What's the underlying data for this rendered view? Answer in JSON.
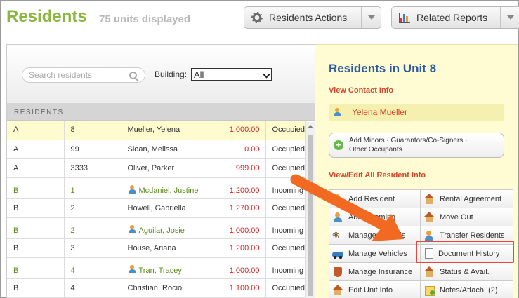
{
  "header": {
    "title": "Residents",
    "count_text": "75 units displayed",
    "actions_button": "Residents Actions",
    "reports_button": "Related Reports"
  },
  "filters": {
    "search_placeholder": "Search residents",
    "building_label": "Building:",
    "building_value": "All"
  },
  "table": {
    "section_label": "RESIDENTS",
    "rows": [
      {
        "building": "A",
        "unit": "8",
        "name": "Mueller, Yelena",
        "amount": "1,000.00",
        "status": "Occupied",
        "highlight": true,
        "person_icon": false,
        "green": false
      },
      {
        "building": "A",
        "unit": "99",
        "name": "Sloan, Melissa",
        "amount": "0.00",
        "status": "Occupied",
        "highlight": false,
        "person_icon": false,
        "green": false
      },
      {
        "building": "A",
        "unit": "3333",
        "name": "Oliver, Parker",
        "amount": "999.00",
        "status": "Occupied",
        "highlight": false,
        "person_icon": false,
        "green": false
      },
      {
        "building": "B",
        "unit": "1",
        "name": "Mcdaniel, Justine",
        "amount": "1,200.00",
        "status": "Incoming",
        "highlight": false,
        "person_icon": true,
        "green": true
      },
      {
        "building": "B",
        "unit": "2",
        "name": "Howell, Gabriella",
        "amount": "1,270.00",
        "status": "Occupied",
        "highlight": false,
        "person_icon": false,
        "green": false
      },
      {
        "building": "B",
        "unit": "2",
        "name": "Aguilar, Josie",
        "amount": "1,000.00",
        "status": "Incoming",
        "highlight": false,
        "person_icon": true,
        "green": true
      },
      {
        "building": "B",
        "unit": "3",
        "name": "House, Ariana",
        "amount": "1,200.00",
        "status": "Occupied",
        "highlight": false,
        "person_icon": false,
        "green": false
      },
      {
        "building": "B",
        "unit": "4",
        "name": "Tran, Tracey",
        "amount": "1,000.00",
        "status": "Incoming",
        "highlight": false,
        "person_icon": true,
        "green": true
      },
      {
        "building": "B",
        "unit": "4",
        "name": "Christian, Rocio",
        "amount": "1,100.00",
        "status": "Occupied",
        "highlight": false,
        "person_icon": false,
        "green": false
      }
    ]
  },
  "panel": {
    "title": "Residents in Unit 8",
    "view_contact": "View Contact Info",
    "contact_name": "Yelena Mueller",
    "minors_line1": "Add Minors · Guarantors/Co-Signers ·",
    "minors_line2": "Other Occupants",
    "view_edit_all": "View/Edit All Resident Info",
    "actions": [
      {
        "label": "Add Resident",
        "icon": "person-icon"
      },
      {
        "label": "Rental Agreement",
        "icon": "house-icon"
      },
      {
        "label": "Add Incoming",
        "icon": "person-icon"
      },
      {
        "label": "Move Out",
        "icon": "house-icon"
      },
      {
        "label": "Manage Animals",
        "icon": "paw-icon"
      },
      {
        "label": "Transfer Residents",
        "icon": "person-icon"
      },
      {
        "label": "Manage Vehicles",
        "icon": "car-icon"
      },
      {
        "label": "Document History",
        "icon": "document-icon"
      },
      {
        "label": "Manage Insurance",
        "icon": "shield-icon"
      },
      {
        "label": "Status & Avail.",
        "icon": "house-icon"
      },
      {
        "label": "Edit Unit Info",
        "icon": "house-icon"
      },
      {
        "label": "Notes/Attach. (2)",
        "icon": "note-icon"
      }
    ]
  },
  "colors": {
    "accent_green": "#8bb63f",
    "title_blue": "#2a5aa0",
    "link_red": "#d2462b",
    "annotation_orange": "#f26a21",
    "highlight_red": "#e8463c"
  }
}
